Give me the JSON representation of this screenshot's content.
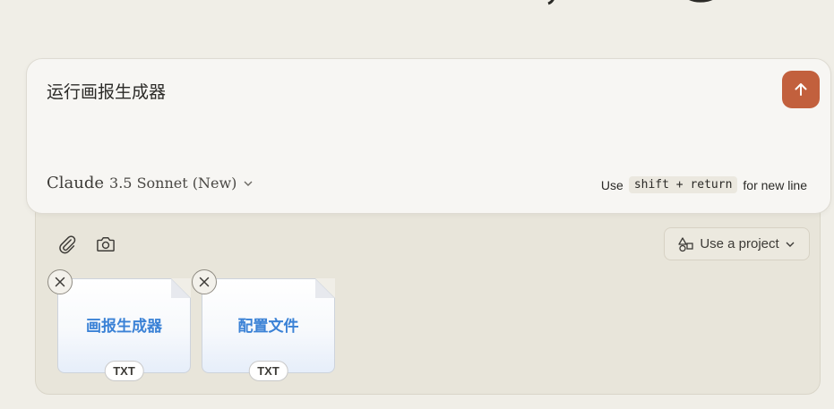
{
  "composer": {
    "prompt_text": "运行画报生成器",
    "model_name": "Claude",
    "model_version": "3.5 Sonnet (New)",
    "hint_prefix": "Use",
    "hint_key": "shift + return",
    "hint_suffix": "for new line",
    "send_icon": "arrow-up-icon"
  },
  "toolbar": {
    "attach_icon": "paperclip-icon",
    "camera_icon": "camera-icon",
    "project_label": "Use a project"
  },
  "attachments": [
    {
      "title": "画报生成器",
      "type": "TXT"
    },
    {
      "title": "配置文件",
      "type": "TXT"
    }
  ],
  "colors": {
    "accent": "#c2603d",
    "file_title": "#3b82d6",
    "background": "#f0eee7"
  }
}
